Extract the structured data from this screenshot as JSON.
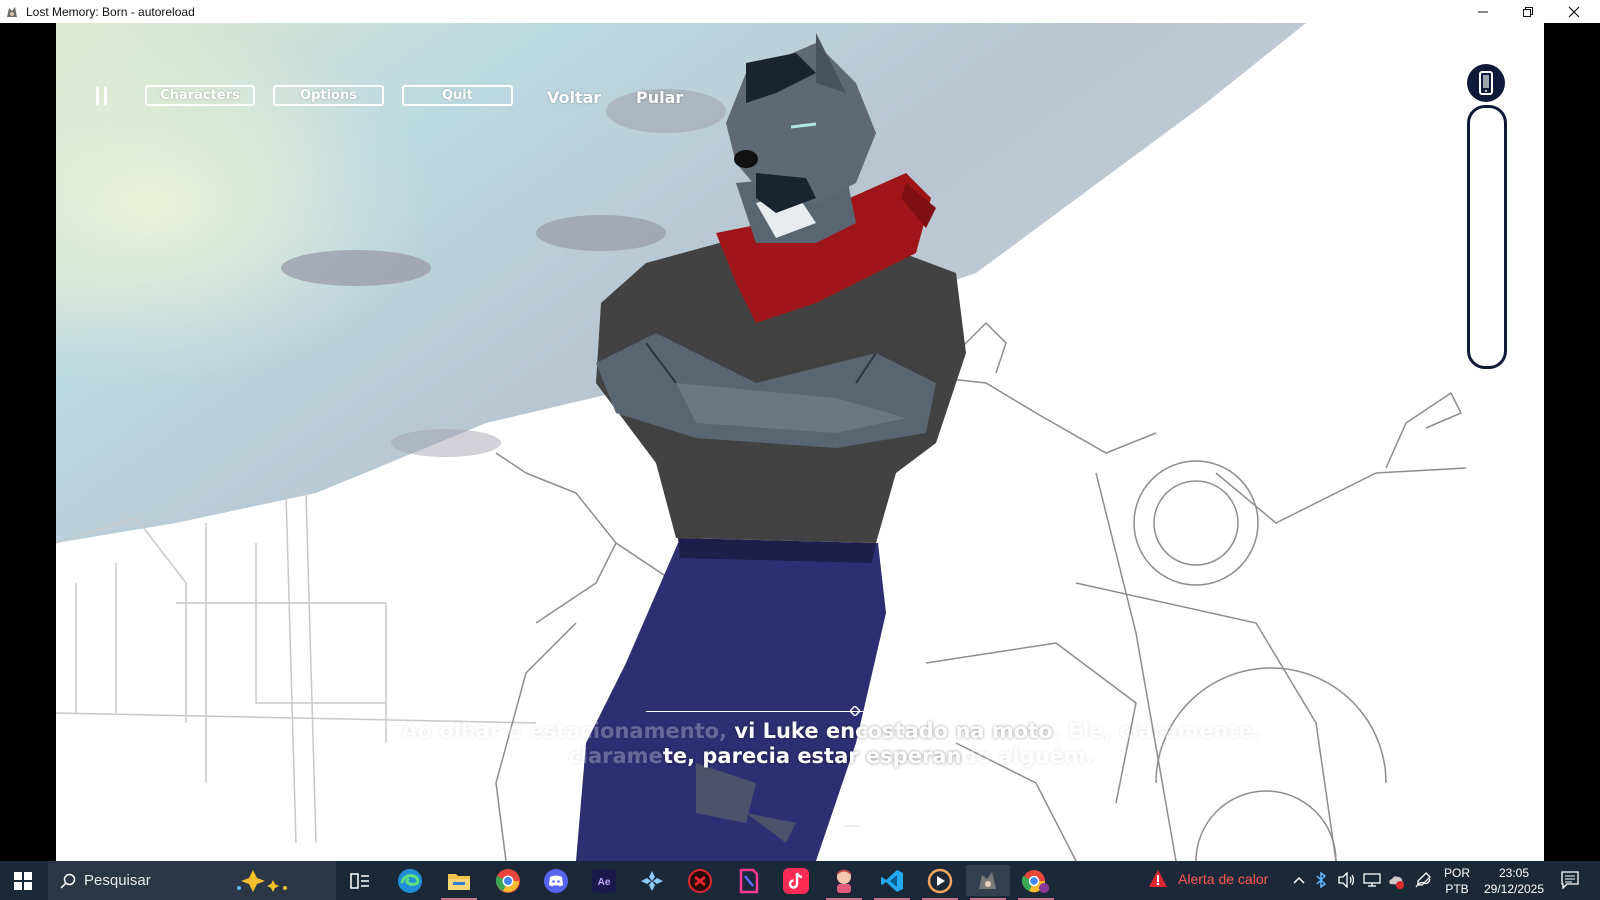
{
  "window": {
    "title": "Lost Memory: Born - autoreload",
    "controls": [
      "minimize",
      "restore",
      "close"
    ]
  },
  "hud": {
    "pause_icon": "pause-icon",
    "buttons": {
      "characters": "Characters",
      "options": "Options",
      "quit": "Quit"
    },
    "links": {
      "back": "Voltar",
      "skip": "Pular"
    },
    "phone_icon": "phone-icon"
  },
  "dialogue": {
    "line1": "Ao olhar o estacionamento, vi Luke encostado na moto. Ele, claramente,",
    "line2": "parecia estar esperando alguém.",
    "visible_fragment1": "vi Luke encostado na moto",
    "visible_fragment2": "te, parecia estar esperan"
  },
  "taskbar": {
    "search_placeholder": "Pesquisar",
    "pinned_icons": [
      "task-view-icon",
      "edge-icon",
      "file-explorer-icon",
      "chrome-icon",
      "discord-icon",
      "after-effects-icon",
      "game-controller-icon",
      "app-red-circle-icon",
      "app-pink-icon",
      "tiktok-icon",
      "character-app-icon",
      "vscode-icon",
      "media-player-icon",
      "game-app-icon",
      "chrome-profile-icon"
    ],
    "heat_alert": "Alerta de calor",
    "language_top": "POR",
    "language_bottom": "PTB",
    "time": "23:05",
    "date": "29/12/2025"
  },
  "colors": {
    "taskbar": "#1b2838",
    "phone_ui": "#0f1a3a",
    "bandana": "#a0151a",
    "jeans": "#2e2f72",
    "shirt": "#424242",
    "fur": "#596570"
  }
}
